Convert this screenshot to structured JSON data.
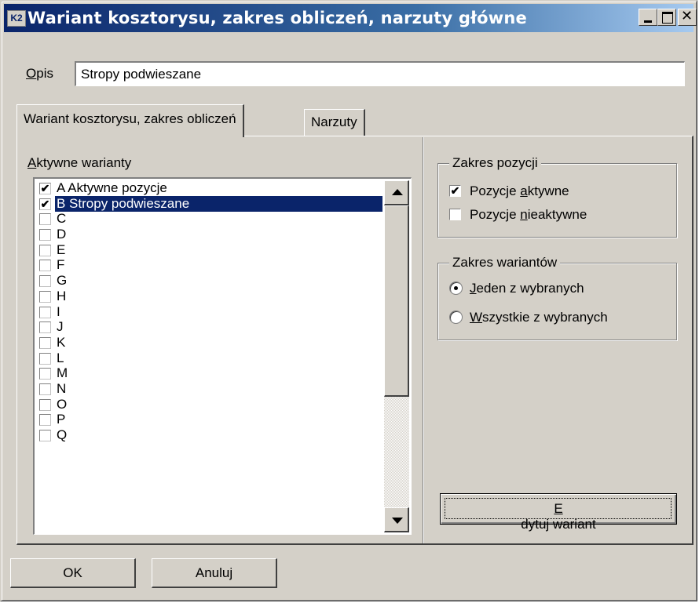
{
  "window": {
    "icon_label": "K2",
    "title": "Wariant kosztorysu, zakres obliczeń, narzuty główne"
  },
  "opis": {
    "label_accel": "O",
    "label_rest": "pis",
    "value": "Stropy podwieszane"
  },
  "tabs": [
    {
      "label": "Wariant kosztorysu, zakres obliczeń",
      "active": true
    },
    {
      "label": "Narzuty",
      "active": false
    }
  ],
  "variants_list": {
    "label_accel": "A",
    "label_rest": "ktywne warianty",
    "items": [
      {
        "label": "A Aktywne pozycje",
        "checked": true,
        "selected": false
      },
      {
        "label": "B Stropy podwieszane",
        "checked": true,
        "selected": true
      },
      {
        "label": "C",
        "checked": false,
        "selected": false
      },
      {
        "label": "D",
        "checked": false,
        "selected": false
      },
      {
        "label": "E",
        "checked": false,
        "selected": false
      },
      {
        "label": "F",
        "checked": false,
        "selected": false
      },
      {
        "label": "G",
        "checked": false,
        "selected": false
      },
      {
        "label": "H",
        "checked": false,
        "selected": false
      },
      {
        "label": "I",
        "checked": false,
        "selected": false
      },
      {
        "label": "J",
        "checked": false,
        "selected": false
      },
      {
        "label": "K",
        "checked": false,
        "selected": false
      },
      {
        "label": "L",
        "checked": false,
        "selected": false
      },
      {
        "label": "M",
        "checked": false,
        "selected": false
      },
      {
        "label": "N",
        "checked": false,
        "selected": false
      },
      {
        "label": "O",
        "checked": false,
        "selected": false
      },
      {
        "label": "P",
        "checked": false,
        "selected": false
      },
      {
        "label": "Q",
        "checked": false,
        "selected": false
      }
    ]
  },
  "zakres_pozycji": {
    "title": "Zakres pozycji",
    "aktywne": {
      "pre": "Pozycje ",
      "accel": "a",
      "post": "ktywne",
      "checked": true
    },
    "nieaktywne": {
      "pre": "Pozycje ",
      "accel": "n",
      "post": "ieaktywne",
      "checked": false
    }
  },
  "zakres_wariantow": {
    "title": "Zakres wariantów",
    "jeden": {
      "pre": "",
      "accel": "J",
      "post": "eden z wybranych",
      "selected": true
    },
    "wszystkie": {
      "pre": "",
      "accel": "W",
      "post": "szystkie z wybranych",
      "selected": false
    }
  },
  "buttons": {
    "edytuj_accel": "E",
    "edytuj_rest": "dytuj wariant",
    "ok": "OK",
    "anuluj": "Anuluj"
  },
  "icons": {
    "check": "✔",
    "close": "✕"
  },
  "colors": {
    "titlebar_start": "#0a246a",
    "titlebar_end": "#a6caf0",
    "selection": "#0a246a",
    "face": "#d4d0c8"
  }
}
